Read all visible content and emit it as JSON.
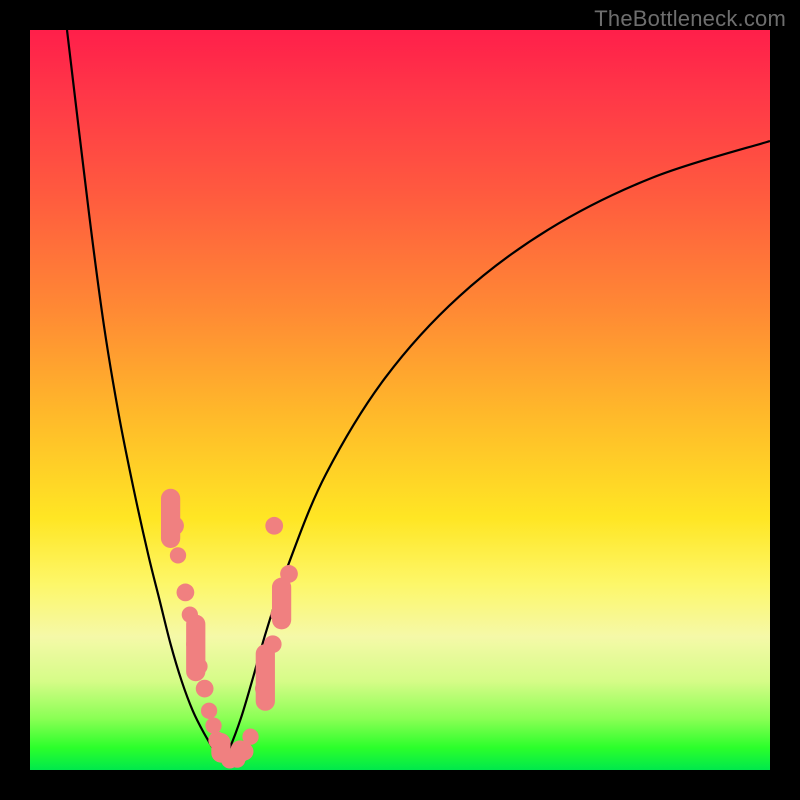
{
  "watermark": "TheBottleneck.com",
  "colors": {
    "dot": "#f08080",
    "curve": "#000000",
    "frame": "#000000"
  },
  "chart_data": {
    "type": "line",
    "title": "",
    "xlabel": "",
    "ylabel": "",
    "xlim": [
      0,
      100
    ],
    "ylim": [
      0,
      100
    ],
    "grid": false,
    "legend": null,
    "note": "V-shaped bottleneck curve on red→green vertical gradient. x,y are percentages of plot area (0,0 = top-left of inner plot). Values are read off the rendered figure; no axis ticks are shown so units are relative.",
    "series": [
      {
        "name": "left-branch",
        "x": [
          5,
          8,
          10,
          12,
          14,
          16,
          17.5,
          19,
          20.5,
          22,
          23.5,
          25,
          26
        ],
        "y": [
          0,
          25,
          40,
          52,
          62,
          71,
          77,
          83,
          88,
          92,
          95,
          97.5,
          98.8
        ]
      },
      {
        "name": "right-branch",
        "x": [
          26,
          27,
          28.5,
          30,
          32,
          35,
          40,
          48,
          58,
          70,
          84,
          100
        ],
        "y": [
          98.8,
          97,
          93,
          88,
          81,
          72,
          60,
          47,
          36,
          27,
          20,
          15
        ]
      }
    ],
    "markers": {
      "note": "Salmon sample points/pills clustered near the trough of the V",
      "points": [
        {
          "x": 19.5,
          "y": 67,
          "r": 1.3
        },
        {
          "x": 20.0,
          "y": 71,
          "r": 1.1
        },
        {
          "x": 21.0,
          "y": 76,
          "r": 1.2
        },
        {
          "x": 21.6,
          "y": 79,
          "r": 1.1
        },
        {
          "x": 22.3,
          "y": 83,
          "r": 1.2
        },
        {
          "x": 22.9,
          "y": 86,
          "r": 1.1
        },
        {
          "x": 23.6,
          "y": 89,
          "r": 1.2
        },
        {
          "x": 24.2,
          "y": 92,
          "r": 1.1
        },
        {
          "x": 24.8,
          "y": 94,
          "r": 1.1
        },
        {
          "x": 25.3,
          "y": 96,
          "r": 1.2
        },
        {
          "x": 26.0,
          "y": 97.8,
          "r": 1.1
        },
        {
          "x": 27.0,
          "y": 98.6,
          "r": 1.2
        },
        {
          "x": 28.0,
          "y": 98.6,
          "r": 1.1
        },
        {
          "x": 29.0,
          "y": 97.5,
          "r": 1.2
        },
        {
          "x": 29.8,
          "y": 95.5,
          "r": 1.1
        },
        {
          "x": 31.5,
          "y": 89,
          "r": 1.1
        },
        {
          "x": 32.8,
          "y": 83,
          "r": 1.2
        },
        {
          "x": 33.6,
          "y": 79,
          "r": 1.1
        },
        {
          "x": 35.0,
          "y": 73.5,
          "r": 1.2
        },
        {
          "x": 33.0,
          "y": 67,
          "r": 1.2
        }
      ],
      "pills": [
        {
          "x": 19.0,
          "y1": 62,
          "y2": 70,
          "w": 2.6
        },
        {
          "x": 22.4,
          "y1": 79,
          "y2": 88,
          "w": 2.6
        },
        {
          "x": 25.8,
          "y1": 95,
          "y2": 99,
          "w": 2.6
        },
        {
          "x": 28.4,
          "y1": 96,
          "y2": 99,
          "w": 2.6
        },
        {
          "x": 31.8,
          "y1": 83,
          "y2": 92,
          "w": 2.6
        },
        {
          "x": 34.0,
          "y1": 74,
          "y2": 81,
          "w": 2.6
        }
      ]
    }
  }
}
